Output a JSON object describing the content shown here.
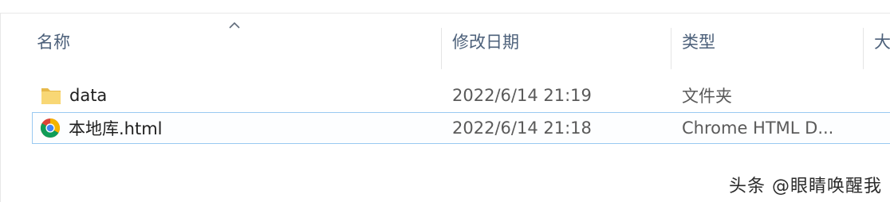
{
  "columns": {
    "name": "名称",
    "modified": "修改日期",
    "type": "类型",
    "size": "大"
  },
  "files": [
    {
      "name": "data",
      "modified": "2022/6/14 21:19",
      "type": "文件夹",
      "icon": "folder-icon",
      "selected": false
    },
    {
      "name": "本地库.html",
      "modified": "2022/6/14 21:18",
      "type": "Chrome HTML D...",
      "icon": "chrome-icon",
      "selected": true
    }
  ],
  "watermark": "头条 @眼睛唤醒我",
  "colors": {
    "header_text": "#4c607a",
    "selection_border": "#99c9f1",
    "folder": "#f8d775"
  }
}
